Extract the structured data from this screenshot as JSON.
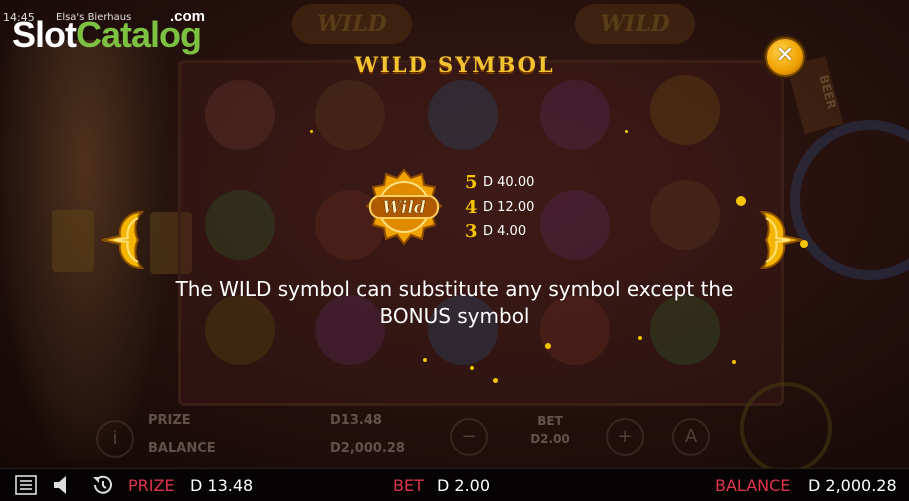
{
  "status": {
    "time": "14:45",
    "game_title": "Elsa's Bierhaus"
  },
  "watermark": {
    "brand_part1": "Slot",
    "brand_part2": "Catalog",
    "domain": ".com"
  },
  "background": {
    "top_wild_labels": [
      "WILD",
      "WILD"
    ],
    "beer_sign": "BEER",
    "panel": {
      "prize_label": "PRIZE",
      "prize_value": "D13.48",
      "balance_label": "BALANCE",
      "balance_value": "D2,000.28",
      "bet_label": "BET",
      "bet_value": "D2.00"
    }
  },
  "paytable": {
    "title": "WILD SYMBOL",
    "close_glyph": "✕",
    "symbol_label": "Wild",
    "payouts": [
      {
        "count": "5",
        "amount": "D 40.00"
      },
      {
        "count": "4",
        "amount": "D 12.00"
      },
      {
        "count": "3",
        "amount": "D 4.00"
      }
    ],
    "description_line1": "The WILD symbol can substitute any symbol except the",
    "description_line2": "BONUS symbol"
  },
  "bottom_bar": {
    "prize_label": "PRIZE",
    "prize_value": "D 13.48",
    "bet_label": "BET",
    "bet_value": "D 2.00",
    "balance_label": "BALANCE",
    "balance_value": "D 2,000.28"
  },
  "icons": [
    "menu-icon",
    "sound-icon",
    "history-icon",
    "close-icon",
    "arrow-left-icon",
    "arrow-right-icon",
    "wild-badge-icon"
  ],
  "colors": {
    "gold": "#f4c430",
    "prize_label": "#e0354a",
    "logo_green": "#7dc142"
  }
}
